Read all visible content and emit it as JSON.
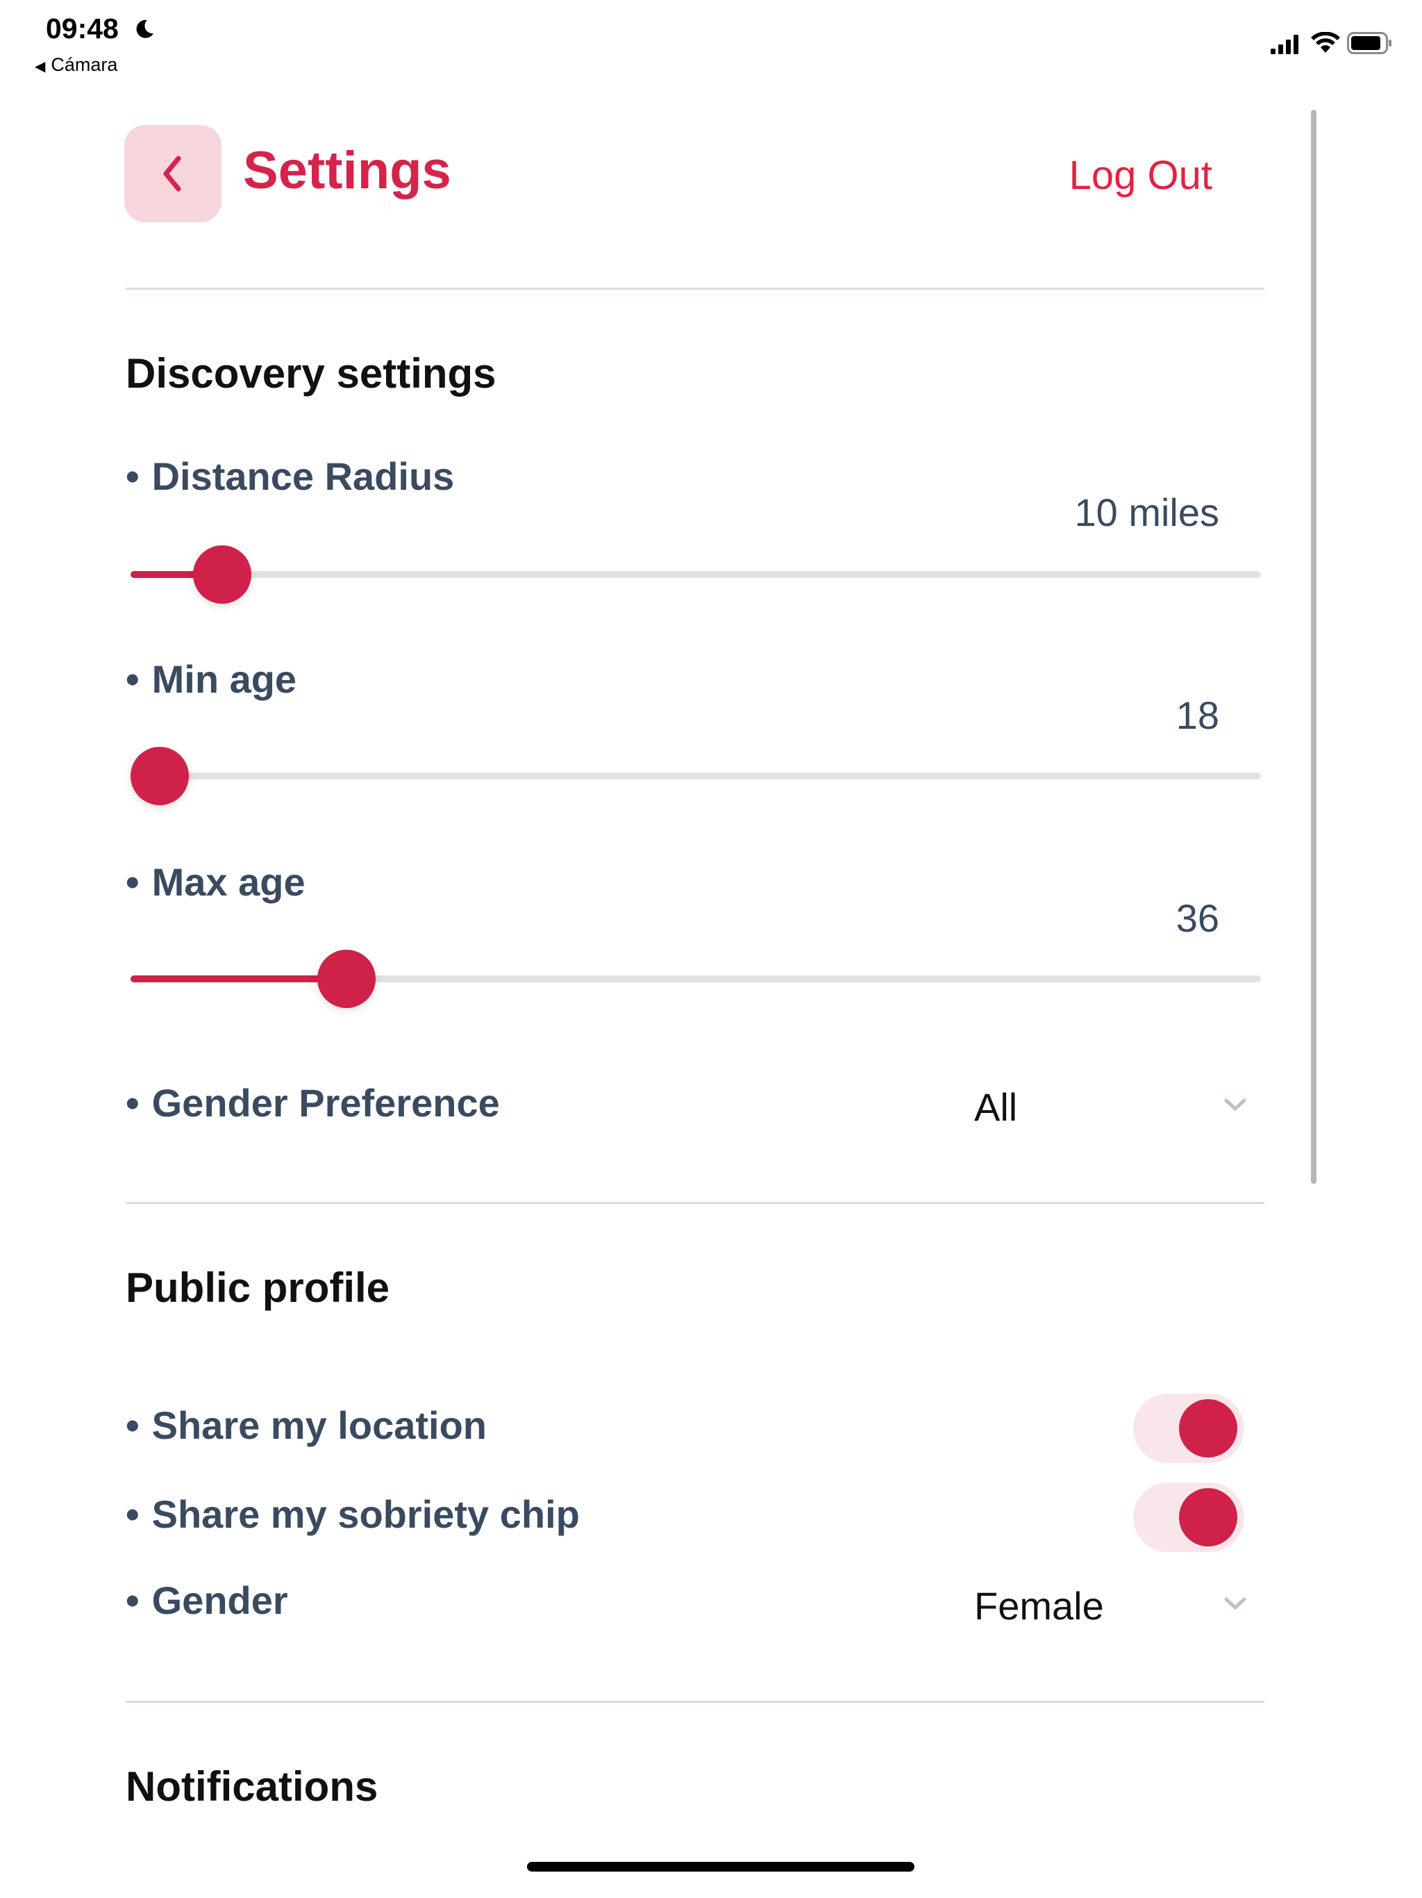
{
  "status_bar": {
    "time": "09:48",
    "back_app": "Cámara",
    "icons": [
      "moon-icon",
      "signal-icon",
      "wifi-icon",
      "battery-icon"
    ]
  },
  "header": {
    "title": "Settings",
    "logout_label": "Log Out",
    "back_icon": "chevron-left-icon"
  },
  "colors": {
    "accent": "#cf2149",
    "accent_light": "#f7d5dc",
    "toggle_track": "#f9e6ea",
    "label": "#3a4a60"
  },
  "discovery": {
    "title": "Discovery settings",
    "distance": {
      "label": "Distance Radius",
      "value": "10 miles",
      "fraction": 0.055
    },
    "min_age": {
      "label": "Min age",
      "value": "18",
      "fraction": 0.0
    },
    "max_age": {
      "label": "Max age",
      "value": "36",
      "fraction": 0.165
    },
    "gender_pref": {
      "label": "Gender Preference",
      "value": "All"
    }
  },
  "public_profile": {
    "title": "Public profile",
    "share_location": {
      "label": "Share my location",
      "on": true
    },
    "share_chip": {
      "label": "Share my sobriety chip",
      "on": true
    },
    "gender": {
      "label": "Gender",
      "value": "Female"
    }
  },
  "notifications": {
    "title": "Notifications"
  }
}
